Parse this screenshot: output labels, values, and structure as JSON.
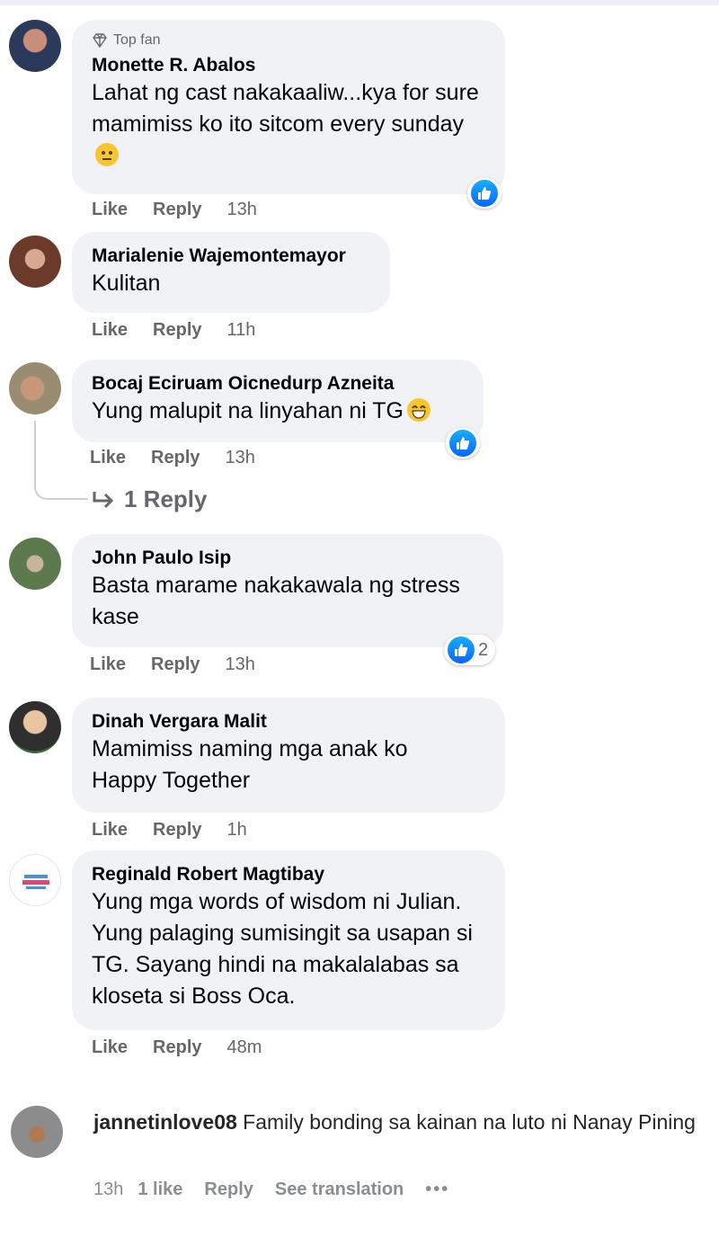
{
  "comments": [
    {
      "badge": "Top fan",
      "name": "Monette R. Abalos",
      "text": "Lahat ng cast nakakaaliw...kya for sure mamimiss ko ito sitcom every sunday",
      "emoji": "neutral-face",
      "like": "Like",
      "reply": "Reply",
      "time": "13h",
      "reaction": "like-reaction",
      "reaction_count": ""
    },
    {
      "name": "Marialenie Wajemontemayor",
      "text": "Kulitan",
      "like": "Like",
      "reply": "Reply",
      "time": "11h"
    },
    {
      "name": "Bocaj Eciruam Oicnedurp Azneita",
      "text": "Yung malupit na linyahan ni TG",
      "emoji": "grinning-face",
      "like": "Like",
      "reply": "Reply",
      "time": "13h",
      "reaction": "like-reaction",
      "reaction_count": "",
      "replies_label": "1 Reply"
    },
    {
      "name": "John Paulo Isip",
      "text": "Basta marame nakakawala ng stress kase",
      "like": "Like",
      "reply": "Reply",
      "time": "13h",
      "reaction": "like-reaction",
      "reaction_count": "2"
    },
    {
      "name": "Dinah Vergara Malit",
      "text": "Mamimiss naming mga anak ko Happy Together",
      "like": "Like",
      "reply": "Reply",
      "time": "1h"
    },
    {
      "name": "Reginald Robert Magtibay",
      "text": "Yung mga words of wisdom ni Julian. Yung palaging sumisingit sa usapan si TG. Sayang hindi na makalalabas sa kloseta si Boss Oca.",
      "like": "Like",
      "reply": "Reply",
      "time": "48m"
    }
  ],
  "instagram_comment": {
    "name": "jannetinlove08",
    "text": "Family bonding sa kainan na luto ni Nanay Pining",
    "time": "13h",
    "likes": "1 like",
    "reply": "Reply",
    "translate": "See translation",
    "more": "•••"
  },
  "colors": {
    "bubble": "#f0f2f5",
    "meta": "#65676b",
    "like_blue": "#0866ff"
  }
}
